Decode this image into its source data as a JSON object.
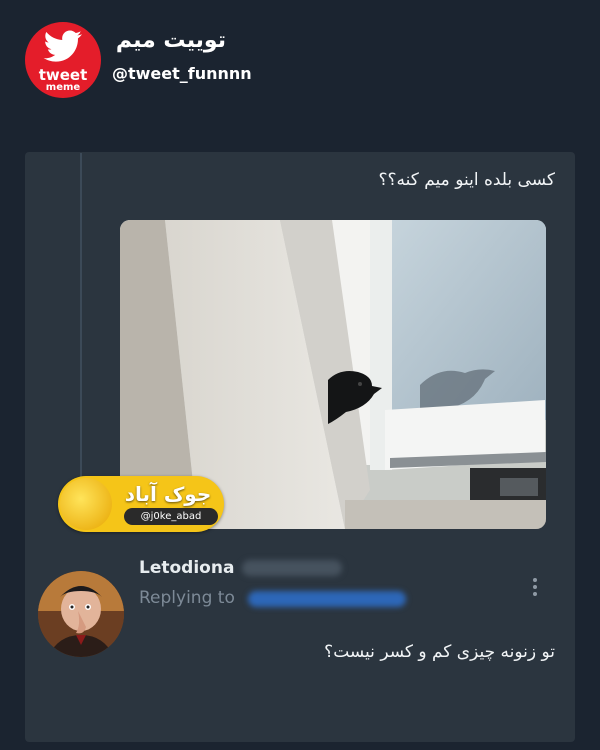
{
  "brand": {
    "title": "توییت میم",
    "handle": "@tweet_funnnn",
    "logo_word": "tweet",
    "logo_sub": "meme",
    "logo_color": "#e41d2a"
  },
  "tweet": {
    "text": "کسی بلده اینو میم کنه؟؟"
  },
  "watermark": {
    "title": "جوک آباد",
    "handle": "@j0ke_abad"
  },
  "reply": {
    "name": "Letodiona",
    "replying_label": "Replying to",
    "text": "تو زنونه چیزی کم و کسر نیست؟"
  },
  "icons": {
    "more": "more-vertical-icon",
    "logo_bird": "twitter-bird-icon"
  }
}
